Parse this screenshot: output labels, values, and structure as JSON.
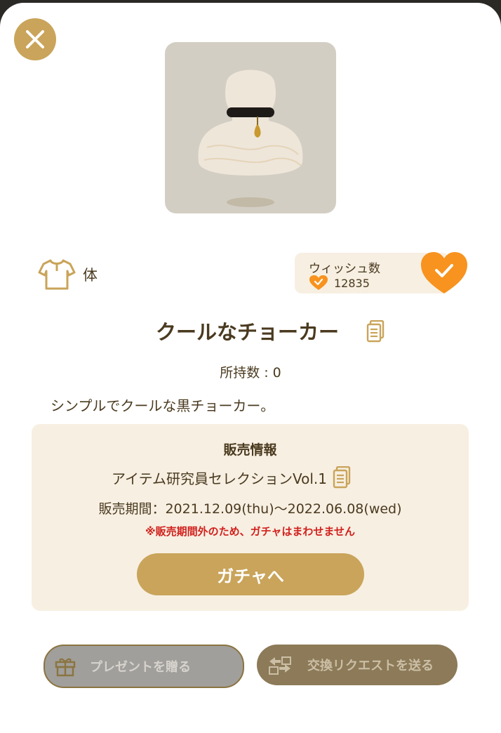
{
  "close": {
    "icon": "close-icon"
  },
  "item": {
    "image_icon": "choker-item-image",
    "slot_label": "体",
    "name": "クールなチョーカー",
    "owned": "所持数 : 0",
    "description": "シンプルでクールな黒チョーカー。"
  },
  "wish": {
    "title": "ウィッシュ数",
    "count": "12835"
  },
  "sale": {
    "title": "販売情報",
    "gacha_name": "アイテム研究員セレクションVol.1",
    "period": "販売期間：2021.12.09(thu)〜2022.06.08(wed)",
    "notice": "※販売期間外のため、ガチャはまわせません",
    "gacha_button": "ガチャへ"
  },
  "buttons": {
    "present": "プレゼントを贈る",
    "trade": "交換リクエストを送る"
  },
  "colors": {
    "accent": "#c9a45a",
    "wish_orange": "#f7931e",
    "notice_red": "#d1201c",
    "panel": "#f7efe2"
  }
}
